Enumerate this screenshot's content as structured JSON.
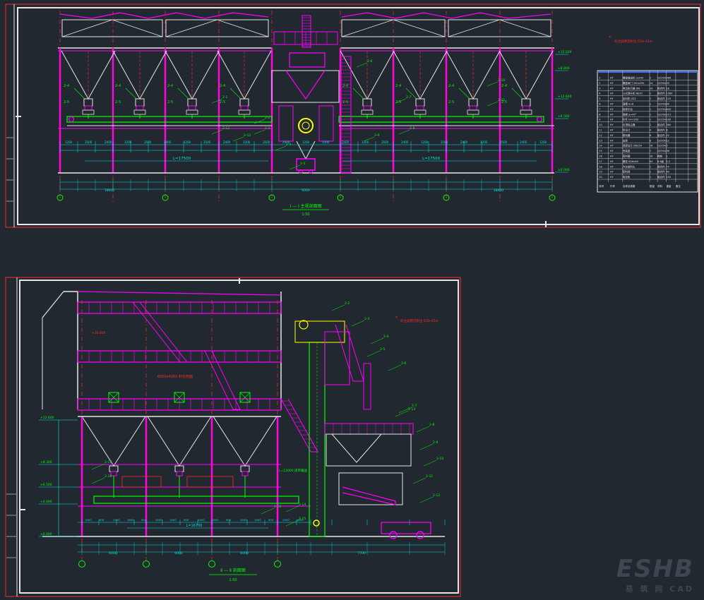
{
  "sheet1": {
    "section_title": "Ⅰ — Ⅰ 主视剖面图",
    "scale": "1:50",
    "red_note": "标注说明见附注 D2b-45m",
    "length_left": "L=17500",
    "length_right": "L=17500",
    "table_header": [
      "序号",
      "代号",
      "名称及规格",
      "数量",
      "材料",
      "重量",
      "备注"
    ],
    "table_rows": [
      [
        "1",
        "HY",
        "螺旋输送机 LS250",
        "2",
        "Q235A",
        "486",
        ""
      ],
      [
        "2",
        "HY",
        "螺旋闸门 250x250",
        "14",
        "Q235A",
        "35",
        ""
      ],
      [
        "3",
        "HY",
        "电动执行器 DKJ",
        "14",
        "组合件",
        "18",
        ""
      ],
      [
        "4",
        "HY",
        "斗式提升机 NE50",
        "1",
        "组合件",
        "1560",
        ""
      ],
      [
        "5",
        "HY",
        "给料机 GZ2",
        "1",
        "组合件",
        "120",
        ""
      ],
      [
        "6",
        "HY",
        "溜槽 δ=6",
        "2",
        "Q235A",
        "84",
        ""
      ],
      [
        "7",
        "HY",
        "检修平台",
        "1",
        "Q235A",
        "640",
        ""
      ],
      [
        "8",
        "HY",
        "钢梯 α=45°",
        "1",
        "Q235A",
        "215",
        ""
      ],
      [
        "9",
        "HY",
        "栏杆 H=1050",
        "1",
        "Q235A",
        "180",
        ""
      ],
      [
        "10",
        "HY",
        "仓顶除尘器",
        "2",
        "组合件",
        "360",
        ""
      ],
      [
        "11",
        "HY",
        "料位计",
        "4",
        "组合件",
        "6",
        ""
      ],
      [
        "12",
        "HY",
        "振动器",
        "6",
        "组合件",
        "22",
        ""
      ],
      [
        "13",
        "HY",
        "支座",
        "8",
        "Q235A",
        "12",
        ""
      ],
      [
        "14",
        "HY",
        "连接法兰 DN250",
        "16",
        "Q235A",
        "5",
        ""
      ],
      [
        "15",
        "HY",
        "吊装梁",
        "1",
        "Q235A",
        "96",
        ""
      ],
      [
        "16",
        "HY",
        "密封圈",
        "16",
        "橡胶",
        "1",
        ""
      ],
      [
        "17",
        "HY",
        "螺栓 M16x60",
        "64",
        "8.8级",
        "0.2",
        ""
      ],
      [
        "18",
        "HY",
        "汽车装料头",
        "1",
        "组合件",
        "75",
        ""
      ],
      [
        "19",
        "HY",
        "卸料阀",
        "2",
        "组合件",
        "40",
        ""
      ],
      [
        "20",
        "HY",
        "电控柜",
        "1",
        "组合件",
        "150",
        ""
      ]
    ],
    "dims_bottom": [
      "18000",
      "6000",
      "18000"
    ],
    "elevations": [
      "+15.500",
      "+12.600",
      "+8.800",
      "+6.500",
      "±0.000"
    ]
  },
  "sheet2": {
    "section_title": "Ⅱ — Ⅱ 剖面图",
    "scale": "1:50",
    "silo_label": "6000x4000 料仓剖面",
    "red_note": "标注说明见附注 D2b-45m",
    "length": "L=16700",
    "belt_label": "L=12000 皮带输送",
    "elevations": [
      "+16.800",
      "+12.600",
      "+8.300",
      "+6.500",
      "+4.000",
      "±0.000"
    ],
    "dims_bottom": [
      "6000",
      "6000",
      "6000",
      "7700"
    ]
  },
  "watermark": {
    "main": "ESHB",
    "sub": "易 筑 网 CAD"
  }
}
